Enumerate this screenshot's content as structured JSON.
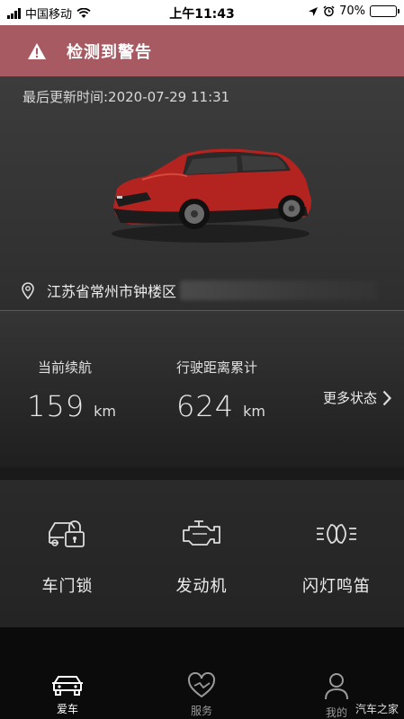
{
  "status_bar": {
    "carrier": "中国移动",
    "time": "上午11:43",
    "battery": "70%",
    "battery_level": 0.7
  },
  "alert": {
    "title": "检测到警告",
    "icon": "warning-icon"
  },
  "vehicle": {
    "last_updated": "最后更新时间:2020-07-29 11:31",
    "location": "江苏省常州市钟楼区"
  },
  "stats": {
    "range_label": "当前续航",
    "range_value": "159",
    "range_unit": "km",
    "odometer_label": "行驶距离累计",
    "odometer_value": "624",
    "odometer_unit": "km",
    "more_label": "更多状态"
  },
  "controls": [
    {
      "label": "车门锁",
      "icon": "car-door-lock-icon"
    },
    {
      "label": "发动机",
      "icon": "engine-icon"
    },
    {
      "label": "闪灯鸣笛",
      "icon": "headlight-horn-icon"
    }
  ],
  "tabs": [
    {
      "label": "爱车",
      "icon": "car-icon",
      "active": true
    },
    {
      "label": "服务",
      "icon": "heart-service-icon",
      "active": false
    },
    {
      "label": "我的",
      "icon": "person-icon",
      "active": false
    }
  ],
  "watermark": "汽车之家",
  "colors": {
    "alert_bg": "#a85a62",
    "car_red": "#b3231f",
    "tab_active": "#ffffff",
    "tab_inactive": "#9a9a9a"
  }
}
